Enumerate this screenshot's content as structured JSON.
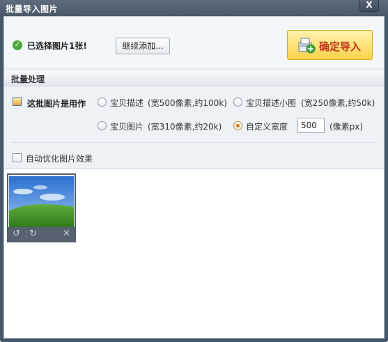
{
  "window": {
    "title": "批量导入图片",
    "close_label": "X"
  },
  "top": {
    "selected_text": "已选择图片1张!",
    "continue_button": "继续添加...",
    "import_button": "确定导入"
  },
  "batch": {
    "section_title": "批量处理",
    "usage_label": "这批图片是用作",
    "options": [
      {
        "label": "宝贝描述",
        "note": "(宽500像素,约100k)",
        "checked": false
      },
      {
        "label": "宝贝描述小图",
        "note": "(宽250像素,约50k)",
        "checked": false
      },
      {
        "label": "宝贝图片",
        "note": "(宽310像素,约20k)",
        "checked": false
      },
      {
        "label": "自定义宽度",
        "checked": true
      }
    ],
    "custom_width_value": "500",
    "custom_width_unit": "(像素px)",
    "auto_optimize_label": "自动优化图片效果"
  },
  "thumbnail": {
    "rotate_left_icon": "↺",
    "rotate_right_icon": "↻",
    "delete_icon": "✕"
  }
}
